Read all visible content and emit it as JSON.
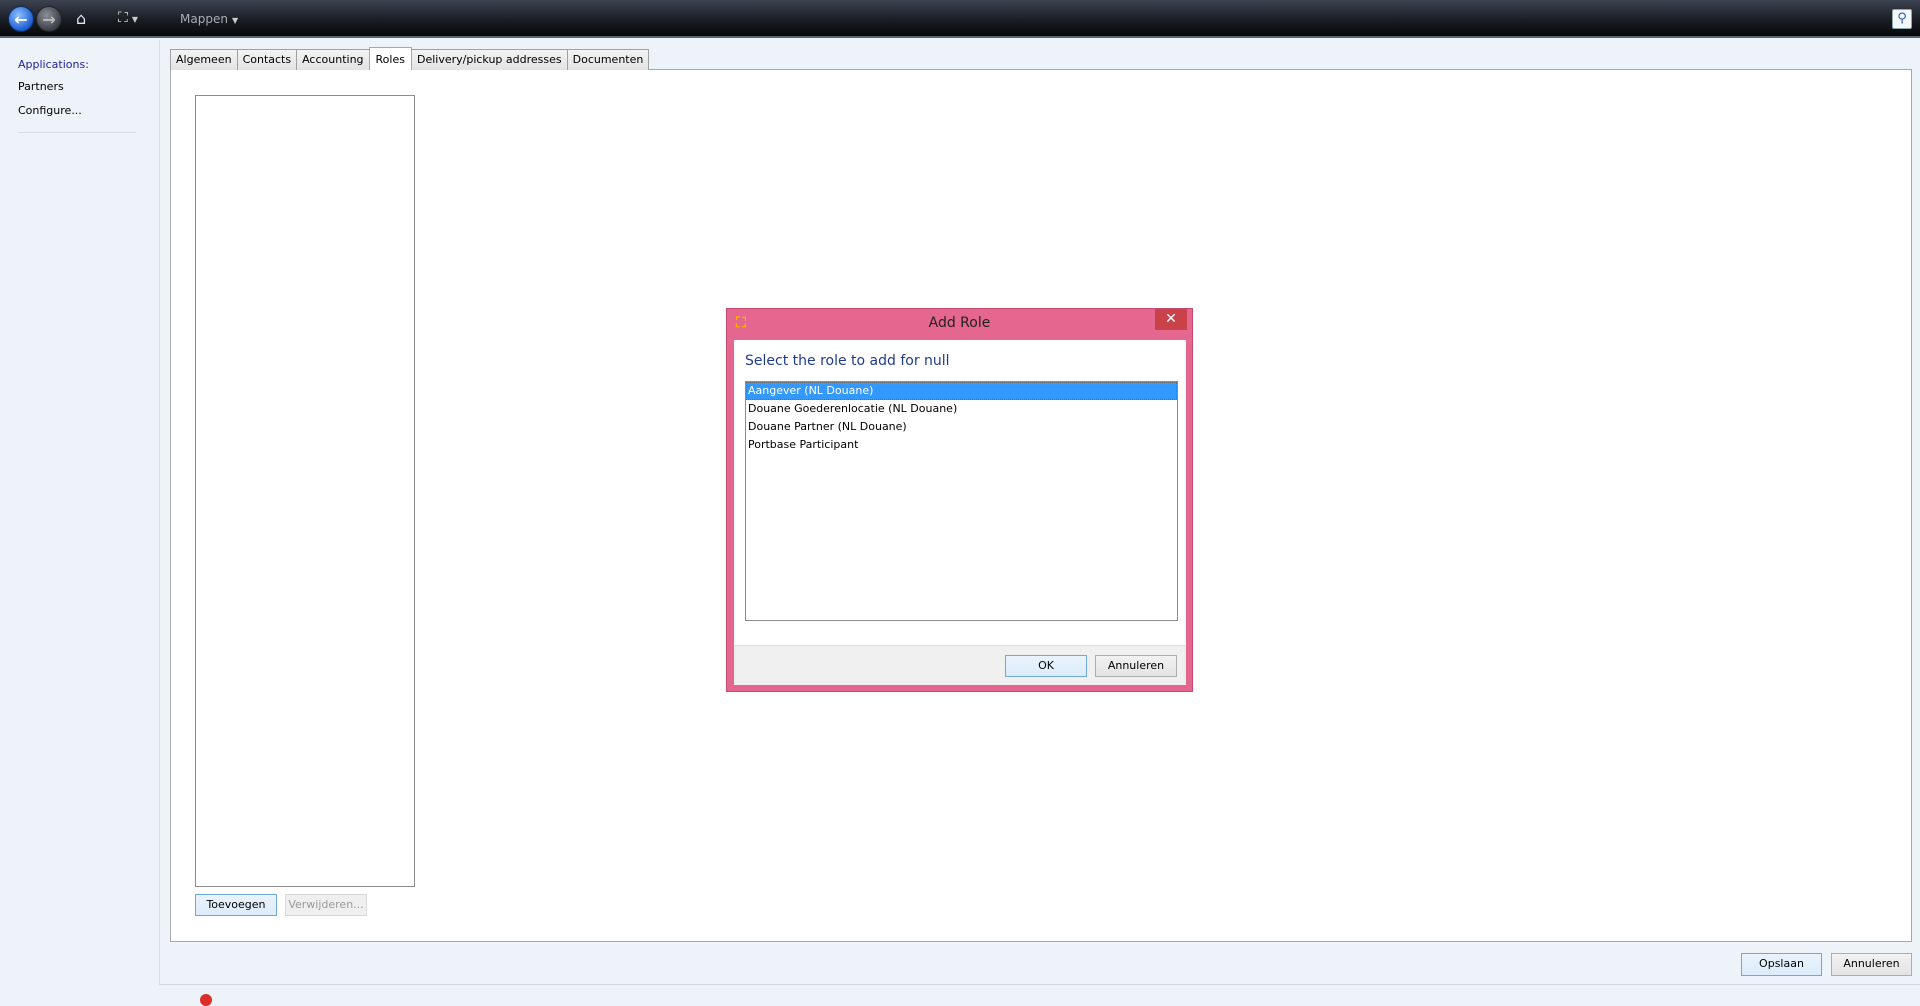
{
  "toolbar": {
    "back_icon": "arrow-left-icon",
    "forward_icon": "arrow-right-icon",
    "home_icon": "home-icon",
    "view_icon": "expand-icon",
    "folders_label": "Mappen",
    "search_icon": "search-icon"
  },
  "sidebar": {
    "items": [
      {
        "label": "Applications:",
        "color": "#1f1fa0"
      },
      {
        "label": "Partners"
      },
      {
        "label": "Configure..."
      }
    ]
  },
  "tabs": [
    {
      "label": "Algemeen"
    },
    {
      "label": "Contacts"
    },
    {
      "label": "Accounting"
    },
    {
      "label": "Roles",
      "active": true
    },
    {
      "label": "Delivery/pickup addresses"
    },
    {
      "label": "Documenten"
    }
  ],
  "roles_panel": {
    "add_label": "Toevoegen",
    "remove_label": "Verwijderen..."
  },
  "footer": {
    "save_label": "Opslaan",
    "cancel_label": "Annuleren"
  },
  "dialog": {
    "title": "Add Role",
    "prompt": "Select the role to add for null",
    "options": [
      "Aangever (NL Douane)",
      "Douane Goederenlocatie (NL Douane)",
      "Douane Partner (NL Douane)",
      "Portbase Participant"
    ],
    "selected_index": 0,
    "ok_label": "OK",
    "cancel_label": "Annuleren",
    "border_color": "#e5668e"
  }
}
